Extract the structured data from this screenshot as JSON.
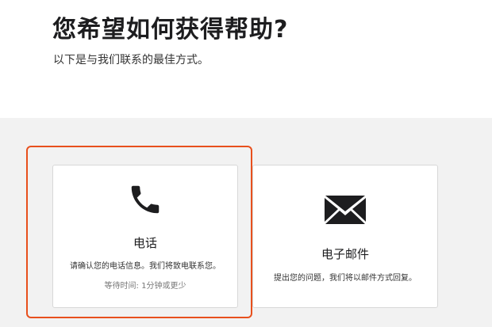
{
  "header": {
    "title": "您希望如何获得帮助?",
    "subtitle": "以下是与我们联系的最佳方式。"
  },
  "options": [
    {
      "icon": "phone-icon",
      "title": "电话",
      "description": "请确认您的电话信息。我们将致电联系您。",
      "wait_time": "等待时间: 1分钟或更少",
      "selected": true
    },
    {
      "icon": "envelope-icon",
      "title": "电子邮件",
      "description": "提出您的问题，我们将以邮件方式回复。"
    }
  ],
  "colors": {
    "highlight": "#e8501d",
    "background": "#f2f2f2",
    "card": "#ffffff",
    "text": "#1d1d1f"
  }
}
